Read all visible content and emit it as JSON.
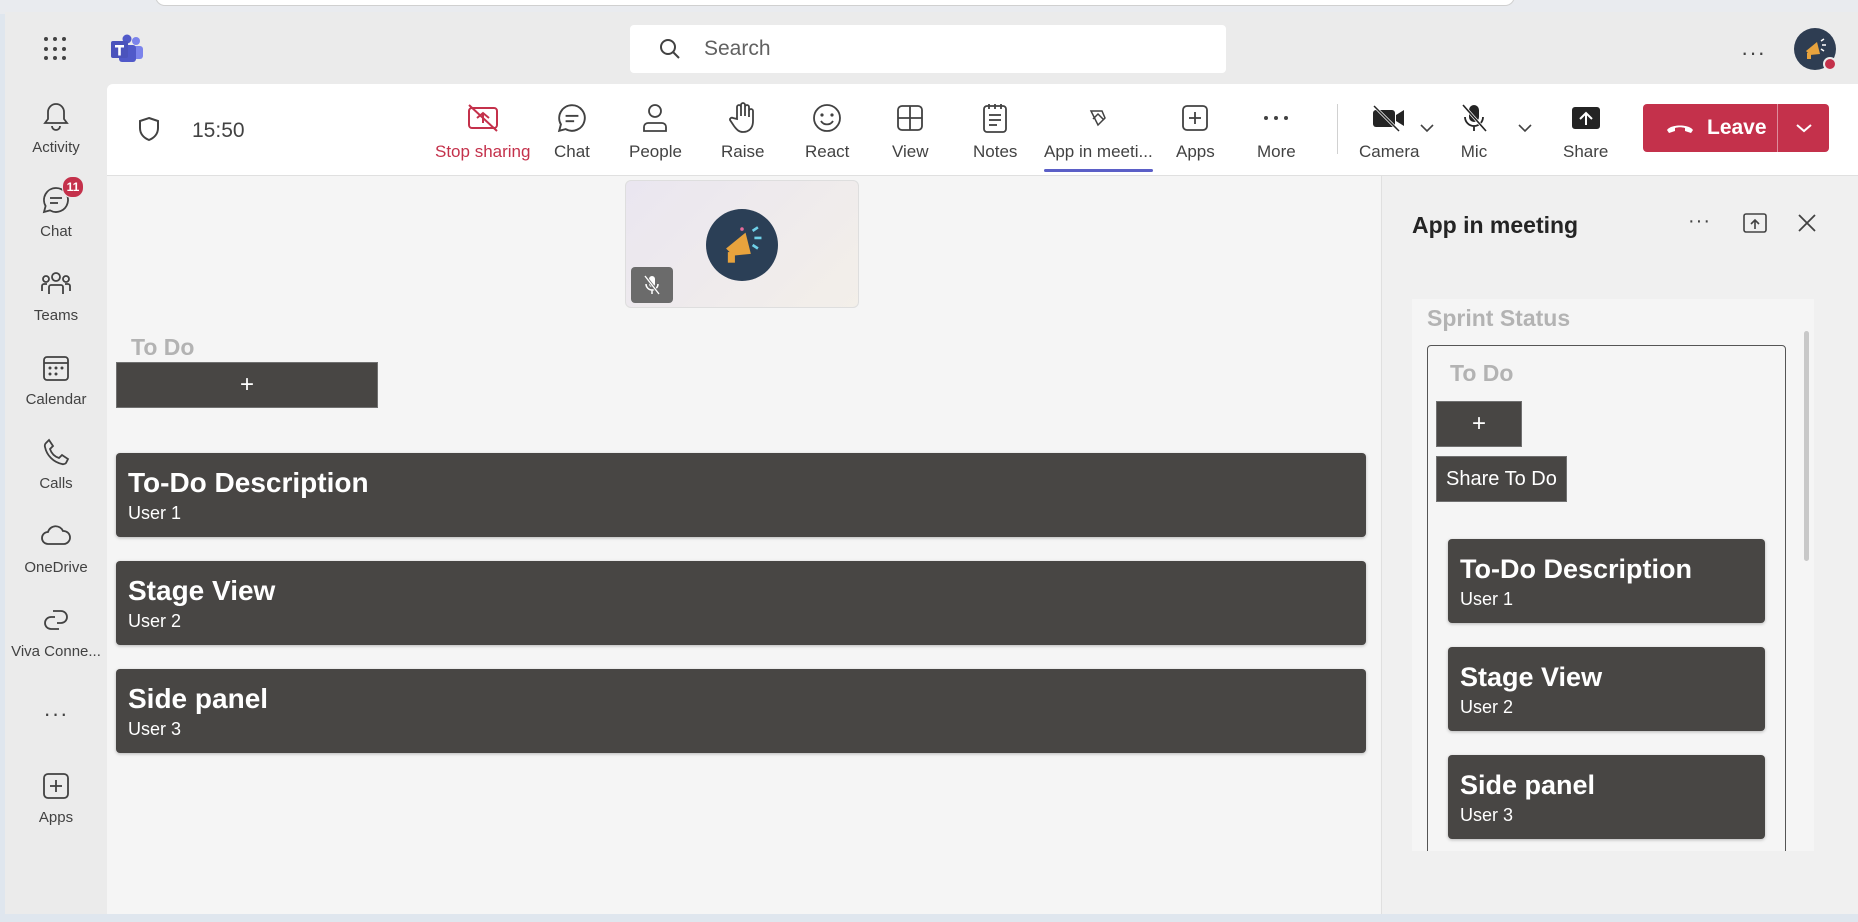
{
  "header": {
    "search_placeholder": "Search",
    "more_label": "···"
  },
  "rail": {
    "items": [
      {
        "label": "Activity"
      },
      {
        "label": "Chat",
        "badge": "11"
      },
      {
        "label": "Teams"
      },
      {
        "label": "Calendar"
      },
      {
        "label": "Calls"
      },
      {
        "label": "OneDrive"
      },
      {
        "label": "Viva Conne..."
      },
      {
        "label": "Apps"
      }
    ],
    "more_label": "···"
  },
  "toolbar": {
    "time": "15:50",
    "buttons": [
      {
        "label": "Stop sharing"
      },
      {
        "label": "Chat"
      },
      {
        "label": "People"
      },
      {
        "label": "Raise"
      },
      {
        "label": "React"
      },
      {
        "label": "View"
      },
      {
        "label": "Notes"
      },
      {
        "label": "App in meeti..."
      },
      {
        "label": "Apps"
      },
      {
        "label": "More"
      },
      {
        "label": "Camera"
      },
      {
        "label": "Mic"
      },
      {
        "label": "Share"
      }
    ],
    "leave_label": "Leave"
  },
  "stage": {
    "heading": "To Do",
    "add_label": "+",
    "cards": [
      {
        "title": "To-Do Description",
        "user": "User 1"
      },
      {
        "title": "Stage View",
        "user": "User 2"
      },
      {
        "title": "Side panel",
        "user": "User 3"
      }
    ]
  },
  "panel": {
    "title": "App in meeting",
    "more_label": "···",
    "sprint_title": "Sprint Status",
    "board_heading": "To Do",
    "add_label": "+",
    "share_label": "Share To Do",
    "cards": [
      {
        "title": "To-Do Description",
        "user": "User 1"
      },
      {
        "title": "Stage View",
        "user": "User 2"
      },
      {
        "title": "Side panel",
        "user": "User 3"
      }
    ]
  },
  "colors": {
    "accent": "#5b5fc7",
    "leave": "#c4314b",
    "card": "#484644"
  }
}
